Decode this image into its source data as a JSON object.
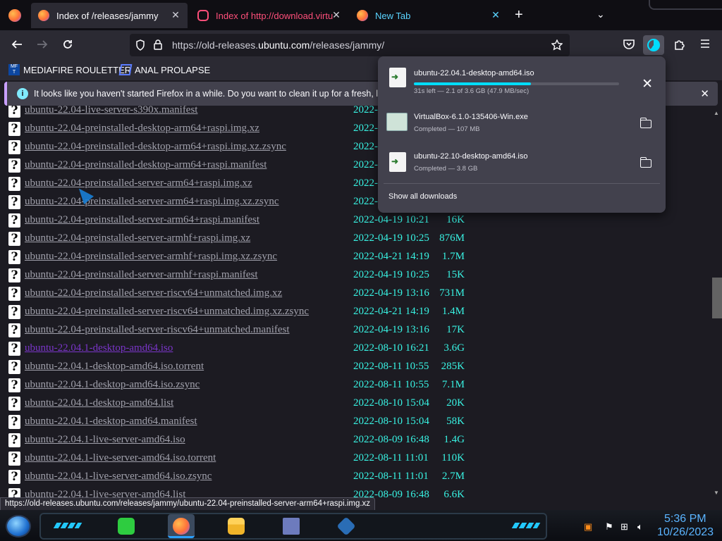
{
  "browser": {
    "tabs": [
      {
        "title": "Index of /releases/jammy"
      },
      {
        "title": "Index of http://download.virtu"
      },
      {
        "title": "New Tab"
      }
    ],
    "new_tab_label": "+",
    "tab_list_label": "⌄",
    "close_label": "✕",
    "url_prefix": "https://old-releases.",
    "url_domain": "ubuntu.com",
    "url_path": "/releases/jammy/",
    "bookmarks": [
      {
        "label": "MEDIAFIRE ROULETTER",
        "icon_text": "MF T"
      },
      {
        "label": "ANAL PROLAPSE"
      }
    ]
  },
  "notification": {
    "message": "It looks like you haven't started Firefox in a while. Do you want to clean it up for a fresh, like-n",
    "info_icon": "i",
    "close_label": "✕"
  },
  "listing": [
    {
      "name": "ubuntu-22.04-live-server-s390x.manifest",
      "date": "2022-",
      "size": ""
    },
    {
      "name": "ubuntu-22.04-preinstalled-desktop-arm64+raspi.img.xz",
      "date": "2022-",
      "size": ""
    },
    {
      "name": "ubuntu-22.04-preinstalled-desktop-arm64+raspi.img.xz.zsync",
      "date": "2022-",
      "size": ""
    },
    {
      "name": "ubuntu-22.04-preinstalled-desktop-arm64+raspi.manifest",
      "date": "2022-",
      "size": ""
    },
    {
      "name": "ubuntu-22.04-preinstalled-server-arm64+raspi.img.xz",
      "date": "2022-",
      "size": ""
    },
    {
      "name": "ubuntu-22.04-preinstalled-server-arm64+raspi.img.xz.zsync",
      "date": "2022-",
      "size": ""
    },
    {
      "name": "ubuntu-22.04-preinstalled-server-arm64+raspi.manifest",
      "date": "2022-04-19 10:21",
      "size": "16K"
    },
    {
      "name": "ubuntu-22.04-preinstalled-server-armhf+raspi.img.xz",
      "date": "2022-04-19 10:25",
      "size": "876M"
    },
    {
      "name": "ubuntu-22.04-preinstalled-server-armhf+raspi.img.xz.zsync",
      "date": "2022-04-21 14:19",
      "size": "1.7M"
    },
    {
      "name": "ubuntu-22.04-preinstalled-server-armhf+raspi.manifest",
      "date": "2022-04-19 10:25",
      "size": "15K"
    },
    {
      "name": "ubuntu-22.04-preinstalled-server-riscv64+unmatched.img.xz",
      "date": "2022-04-19 13:16",
      "size": "731M"
    },
    {
      "name": "ubuntu-22.04-preinstalled-server-riscv64+unmatched.img.xz.zsync",
      "date": "2022-04-21 14:19",
      "size": "1.4M"
    },
    {
      "name": "ubuntu-22.04-preinstalled-server-riscv64+unmatched.manifest",
      "date": "2022-04-19 13:16",
      "size": "17K"
    },
    {
      "name": "ubuntu-22.04.1-desktop-amd64.iso",
      "date": "2022-08-10 16:21",
      "size": "3.6G",
      "visited": true
    },
    {
      "name": "ubuntu-22.04.1-desktop-amd64.iso.torrent",
      "date": "2022-08-11 10:55",
      "size": "285K"
    },
    {
      "name": "ubuntu-22.04.1-desktop-amd64.iso.zsync",
      "date": "2022-08-11 10:55",
      "size": "7.1M"
    },
    {
      "name": "ubuntu-22.04.1-desktop-amd64.list",
      "date": "2022-08-10 15:04",
      "size": "20K"
    },
    {
      "name": "ubuntu-22.04.1-desktop-amd64.manifest",
      "date": "2022-08-10 15:04",
      "size": "58K"
    },
    {
      "name": "ubuntu-22.04.1-live-server-amd64.iso",
      "date": "2022-08-09 16:48",
      "size": "1.4G"
    },
    {
      "name": "ubuntu-22.04.1-live-server-amd64.iso.torrent",
      "date": "2022-08-11 11:01",
      "size": "110K"
    },
    {
      "name": "ubuntu-22.04.1-live-server-amd64.iso.zsync",
      "date": "2022-08-11 11:01",
      "size": "2.7M"
    },
    {
      "name": "ubuntu-22.04.1-live-server-amd64.list",
      "date": "2022-08-09 16:48",
      "size": "6.6K"
    }
  ],
  "downloads": {
    "items": [
      {
        "file": "ubuntu-22.04.1-desktop-amd64.iso",
        "status": "31s left — 2.1 of 3.6 GB (47.9 MB/sec)",
        "progress": 0.57
      },
      {
        "file": "VirtualBox-6.1.0-135406-Win.exe",
        "status": "Completed — 107 MB"
      },
      {
        "file": "ubuntu-22.10-desktop-amd64.iso",
        "status": "Completed — 3.8 GB"
      }
    ],
    "show_all": "Show all downloads",
    "cancel_label": "✕"
  },
  "status_url": "https://old-releases.ubuntu.com/releases/jammy/ubuntu-22.04-preinstalled-server-arm64+raspi.img.xz",
  "taskbar": {
    "time": "5:36 PM",
    "date": "10/26/2023"
  },
  "colors": {
    "accent": "#00ddff",
    "listing_text": "#38f3e3",
    "link": "#a0a0ab",
    "visited": "#7a35c9",
    "clock": "#5ab4ff"
  }
}
